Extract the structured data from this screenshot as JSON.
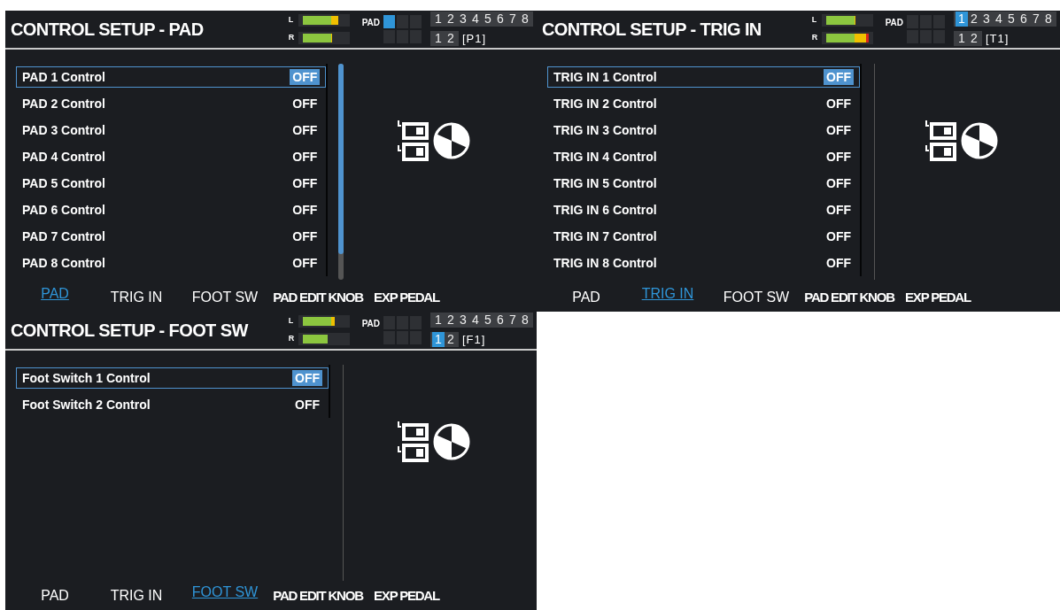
{
  "screens": [
    {
      "title": "CONTROL SETUP - PAD",
      "meters": [
        {
          "label": "L",
          "level": 0.85
        },
        {
          "label": "R",
          "level": 0.7
        }
      ],
      "pad_label": "PAD",
      "pads": [
        {
          "selected": true
        },
        {
          "selected": false
        },
        {
          "selected": false
        },
        {
          "selected": false
        },
        {
          "selected": false
        },
        {
          "selected": false
        }
      ],
      "parts": [
        {
          "label": "1",
          "selected": false
        },
        {
          "label": "2",
          "selected": false
        },
        {
          "label": "3",
          "selected": false
        },
        {
          "label": "4",
          "selected": false
        },
        {
          "label": "5",
          "selected": false
        },
        {
          "label": "6",
          "selected": false
        },
        {
          "label": "7",
          "selected": false
        },
        {
          "label": "8",
          "selected": false
        }
      ],
      "layers": [
        {
          "label": "1",
          "selected": false
        },
        {
          "label": "2",
          "selected": false
        }
      ],
      "tag": "[P1]",
      "rows": [
        {
          "label": "PAD 1 Control",
          "value": "OFF",
          "selected": true
        },
        {
          "label": "PAD 2 Control",
          "value": "OFF",
          "selected": false
        },
        {
          "label": "PAD 3 Control",
          "value": "OFF",
          "selected": false
        },
        {
          "label": "PAD 4 Control",
          "value": "OFF",
          "selected": false
        },
        {
          "label": "PAD 5 Control",
          "value": "OFF",
          "selected": false
        },
        {
          "label": "PAD 6 Control",
          "value": "OFF",
          "selected": false
        },
        {
          "label": "PAD 7 Control",
          "value": "OFF",
          "selected": false
        },
        {
          "label": "PAD 8 Control",
          "value": "OFF",
          "selected": false
        }
      ],
      "scrollbar": true,
      "tabs": [
        {
          "label": "PAD",
          "selected": true
        },
        {
          "label": "TRIG IN",
          "selected": false
        },
        {
          "label": "FOOT SW",
          "selected": false
        },
        {
          "label": "PAD EDIT KNOB",
          "selected": false
        },
        {
          "label": "EXP PEDAL",
          "selected": false
        }
      ]
    },
    {
      "title": "CONTROL SETUP - TRIG IN",
      "meters": [
        {
          "label": "L",
          "level": 0.7
        },
        {
          "label": "R",
          "level": 1.0
        }
      ],
      "pad_label": "PAD",
      "pads": [
        {
          "selected": false
        },
        {
          "selected": false
        },
        {
          "selected": false
        },
        {
          "selected": false
        },
        {
          "selected": false
        },
        {
          "selected": false
        }
      ],
      "parts": [
        {
          "label": "1",
          "selected": true
        },
        {
          "label": "2",
          "selected": false
        },
        {
          "label": "3",
          "selected": false
        },
        {
          "label": "4",
          "selected": false
        },
        {
          "label": "5",
          "selected": false
        },
        {
          "label": "6",
          "selected": false
        },
        {
          "label": "7",
          "selected": false
        },
        {
          "label": "8",
          "selected": false
        }
      ],
      "layers": [
        {
          "label": "1",
          "selected": false
        },
        {
          "label": "2",
          "selected": false
        }
      ],
      "tag": "[T1]",
      "rows": [
        {
          "label": "TRIG IN 1 Control",
          "value": "OFF",
          "selected": true
        },
        {
          "label": "TRIG IN 2 Control",
          "value": "OFF",
          "selected": false
        },
        {
          "label": "TRIG IN 3 Control",
          "value": "OFF",
          "selected": false
        },
        {
          "label": "TRIG IN 4 Control",
          "value": "OFF",
          "selected": false
        },
        {
          "label": "TRIG IN 5 Control",
          "value": "OFF",
          "selected": false
        },
        {
          "label": "TRIG IN 6 Control",
          "value": "OFF",
          "selected": false
        },
        {
          "label": "TRIG IN 7 Control",
          "value": "OFF",
          "selected": false
        },
        {
          "label": "TRIG IN 8 Control",
          "value": "OFF",
          "selected": false
        }
      ],
      "tabs": [
        {
          "label": "PAD",
          "selected": false
        },
        {
          "label": "TRIG IN",
          "selected": true
        },
        {
          "label": "FOOT SW",
          "selected": false
        },
        {
          "label": "PAD EDIT KNOB",
          "selected": false
        },
        {
          "label": "EXP PEDAL",
          "selected": false
        }
      ]
    },
    {
      "title": "CONTROL SETUP - FOOT SW",
      "meters": [
        {
          "label": "L",
          "level": 0.75
        },
        {
          "label": "R",
          "level": 0.6
        }
      ],
      "pad_label": "PAD",
      "pads": [
        {
          "selected": false
        },
        {
          "selected": false
        },
        {
          "selected": false
        },
        {
          "selected": false
        },
        {
          "selected": false
        },
        {
          "selected": false
        }
      ],
      "parts": [
        {
          "label": "1",
          "selected": false
        },
        {
          "label": "2",
          "selected": false
        },
        {
          "label": "3",
          "selected": false
        },
        {
          "label": "4",
          "selected": false
        },
        {
          "label": "5",
          "selected": false
        },
        {
          "label": "6",
          "selected": false
        },
        {
          "label": "7",
          "selected": false
        },
        {
          "label": "8",
          "selected": false
        }
      ],
      "layers": [
        {
          "label": "1",
          "selected": true
        },
        {
          "label": "2",
          "selected": false
        }
      ],
      "tag": "[F1]",
      "rows": [
        {
          "label": "Foot Switch 1 Control",
          "value": "OFF",
          "selected": true
        },
        {
          "label": "Foot Switch 2 Control",
          "value": "OFF",
          "selected": false
        }
      ],
      "tabs": [
        {
          "label": "PAD",
          "selected": false
        },
        {
          "label": "TRIG IN",
          "selected": false
        },
        {
          "label": "FOOT SW",
          "selected": true
        },
        {
          "label": "PAD EDIT KNOB",
          "selected": false
        },
        {
          "label": "EXP PEDAL",
          "selected": false
        }
      ]
    }
  ]
}
